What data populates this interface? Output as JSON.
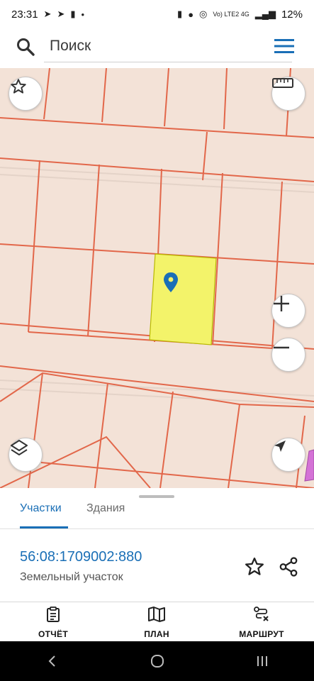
{
  "status": {
    "time": "23:31",
    "battery": "12%",
    "network_label": "Vo) LTE2 4G"
  },
  "search": {
    "placeholder": "Поиск"
  },
  "map": {
    "highlight_color": "#f3f36a",
    "parcel_line_color": "#e2674a",
    "marker_color": "#1a6fb6"
  },
  "sheet": {
    "tabs": [
      {
        "label": "Участки",
        "active": true
      },
      {
        "label": "Здания",
        "active": false
      }
    ],
    "parcel": {
      "cadastral_number": "56:08:1709002:880",
      "type": "Земельный участок"
    }
  },
  "bottom_nav": [
    {
      "label": "ОТЧЁТ",
      "icon": "report-icon"
    },
    {
      "label": "ПЛАН",
      "icon": "map-plan-icon"
    },
    {
      "label": "МАРШРУТ",
      "icon": "route-icon"
    }
  ]
}
